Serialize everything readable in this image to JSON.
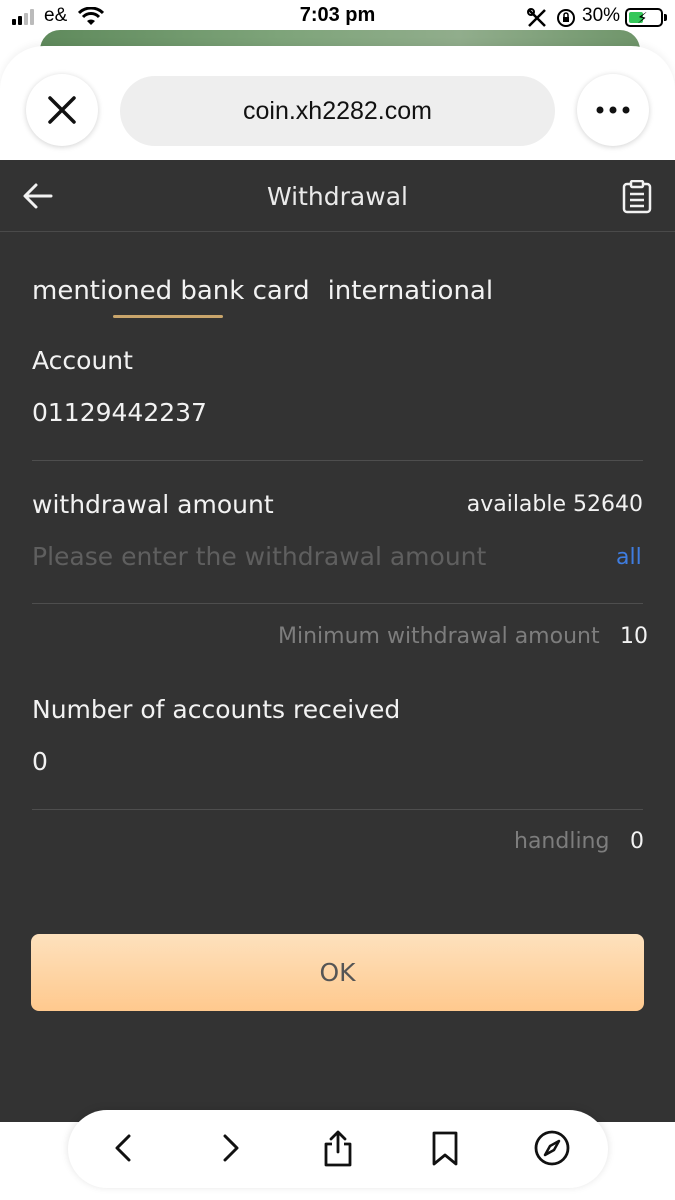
{
  "status_bar": {
    "carrier": "e&",
    "time": "7:03 pm",
    "battery_percent": "30%"
  },
  "browser": {
    "url": "coin.xh2282.com"
  },
  "header": {
    "title": "Withdrawal"
  },
  "tabs": [
    {
      "label": "mentioned bank card",
      "active": true
    },
    {
      "label": "international",
      "active": false
    }
  ],
  "account": {
    "label": "Account",
    "value": "01129442237"
  },
  "withdrawal": {
    "label": "withdrawal amount",
    "available": "available 52640",
    "placeholder": "Please enter the withdrawal amount",
    "all_label": "all",
    "minimum_label": "Minimum withdrawal amount",
    "minimum_value": "10"
  },
  "received": {
    "label": "Number of accounts received",
    "value": "0",
    "handling_label": "handling",
    "handling_value": "0"
  },
  "ok_button": {
    "label": "OK"
  },
  "colors": {
    "background": "#333333",
    "tab_underline": "#c9a56b",
    "link": "#3f7de0",
    "button": "#ffc98e"
  }
}
